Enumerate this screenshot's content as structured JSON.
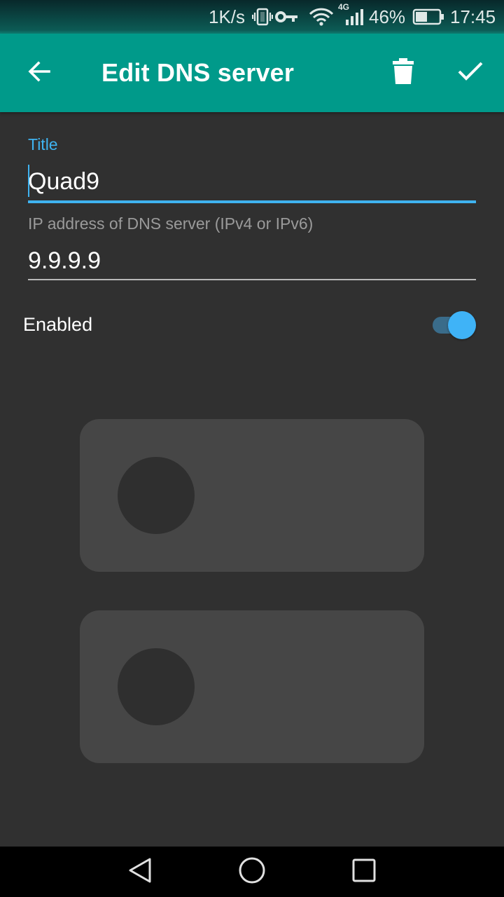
{
  "status_bar": {
    "net_speed": "1K/s",
    "network_type": "4G",
    "battery_percent": "46%",
    "time": "17:45",
    "icons": [
      "vibrate-icon",
      "vpn-key-icon",
      "wifi-icon",
      "signal-icon",
      "battery-icon"
    ]
  },
  "app_bar": {
    "title": "Edit DNS server",
    "icons": [
      "back-arrow-icon",
      "delete-icon",
      "check-icon"
    ]
  },
  "form": {
    "title_label": "Title",
    "title_value": "Quad9",
    "ip_label": "IP address of DNS server (IPv4 or IPv6)",
    "ip_value": "9.9.9.9",
    "enabled_label": "Enabled",
    "enabled": true
  },
  "colors": {
    "app_bar": "#009a8a",
    "accent": "#3fb3f0",
    "background": "#303030",
    "placeholder_card": "#464646"
  },
  "nav_bar": {
    "icons": [
      "back-triangle-icon",
      "home-circle-icon",
      "recents-square-icon"
    ]
  }
}
